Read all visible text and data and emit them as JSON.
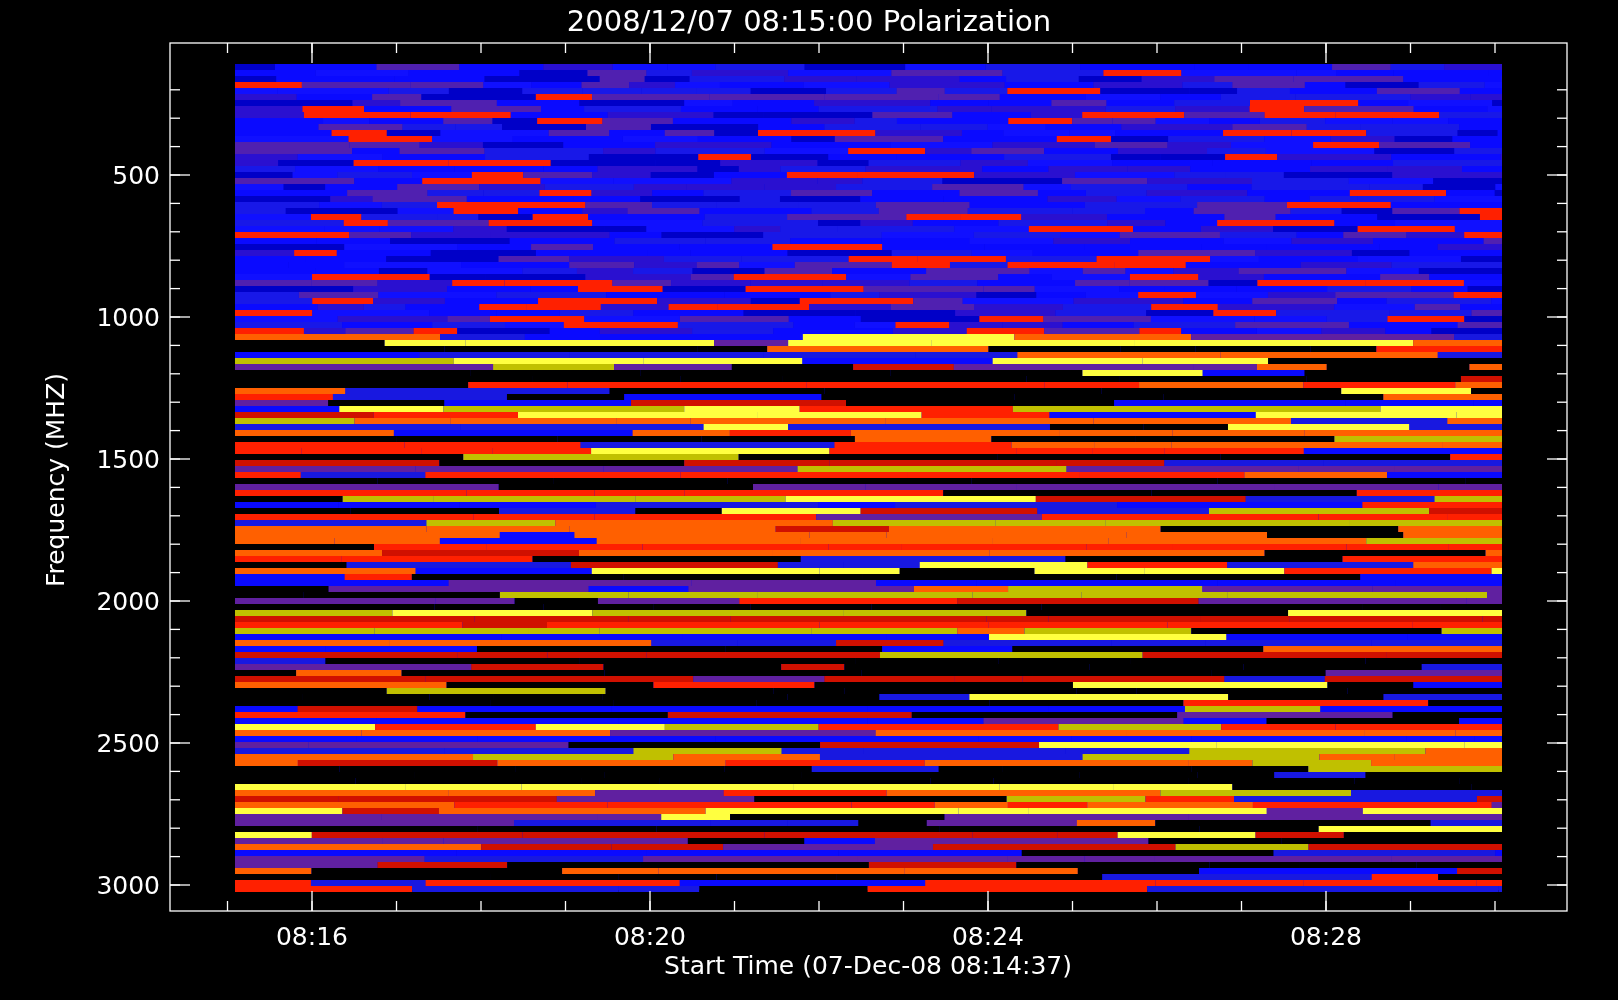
{
  "title": "2008/12/07 08:15:00 Polarization",
  "ylabel": "Frequency (MHZ)",
  "xlabel": "Start Time (07-Dec-08 08:14:37)",
  "yticks": [
    {
      "label": "500"
    },
    {
      "label": "1000"
    },
    {
      "label": "1500"
    },
    {
      "label": "2000"
    },
    {
      "label": "2500"
    },
    {
      "label": "3000"
    }
  ],
  "xticks": [
    {
      "label": "08:16"
    },
    {
      "label": "08:20"
    },
    {
      "label": "08:24"
    },
    {
      "label": "08:28"
    }
  ]
}
